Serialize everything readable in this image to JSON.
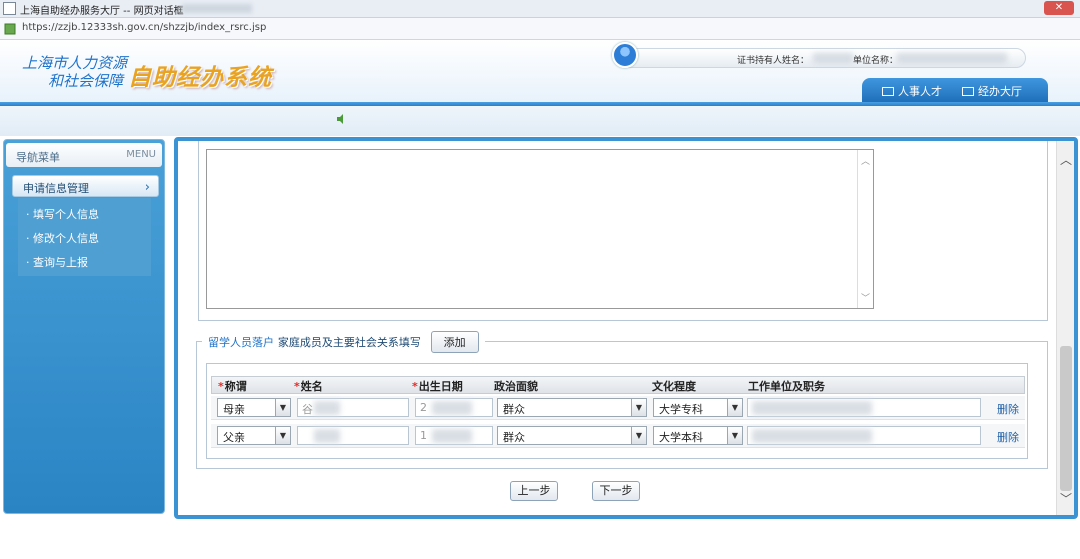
{
  "window": {
    "title": "上海自助经办服务大厅 -- 网页对话框",
    "url": "https://zzjb.12333sh.gov.cn/shzzjb/index_rsrc.jsp"
  },
  "header": {
    "logo_line1": "上海市人力资源",
    "logo_line2": "和社会保障",
    "logo_system": "自助经办系统",
    "holder_label": "证书持有人姓名：",
    "unit_label": "单位名称：",
    "tabs": [
      {
        "label": "人事人才",
        "icon": "book-icon"
      },
      {
        "label": "经办大厅",
        "icon": "building-icon"
      }
    ]
  },
  "sidebar": {
    "title": "导航菜单",
    "menu_en": "MENU",
    "section": "申请信息管理",
    "items": [
      {
        "label": "填写个人信息"
      },
      {
        "label": "修改个人信息"
      },
      {
        "label": "查询与上报"
      }
    ]
  },
  "form": {
    "legend_part1": "留学人员落户",
    "legend_part2": "家庭成员及主要社会关系填写",
    "add_label": "添加",
    "columns": [
      {
        "label": "称谓",
        "required": true
      },
      {
        "label": "姓名",
        "required": true
      },
      {
        "label": "出生日期",
        "required": true
      },
      {
        "label": "政治面貌",
        "required": false
      },
      {
        "label": "文化程度",
        "required": false
      },
      {
        "label": "工作单位及职务",
        "required": false
      }
    ],
    "rows": [
      {
        "relation": "母亲",
        "name": "谷",
        "birth": "2",
        "political": "群众",
        "education": "大学专科",
        "delete": "删除"
      },
      {
        "relation": "父亲",
        "name": "",
        "birth": "1",
        "political": "群众",
        "education": "大学本科",
        "delete": "删除"
      }
    ],
    "prev_label": "上一步",
    "next_label": "下一步"
  },
  "colors": {
    "accent": "#3b93d3",
    "sidebar": "#2a84c4",
    "logo_blue": "#1f73c9",
    "logo_orange": "#e9a321",
    "required": "#d9302c"
  }
}
